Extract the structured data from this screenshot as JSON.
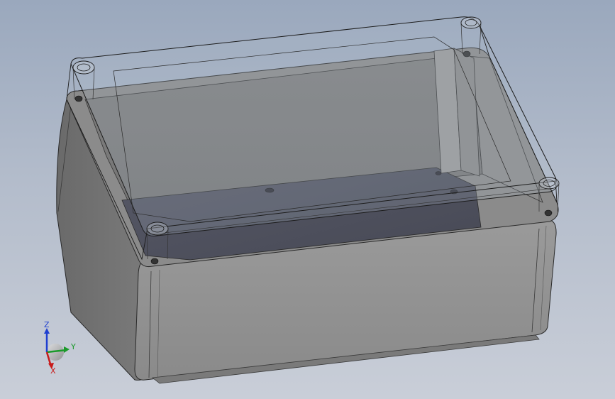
{
  "axis_triad": {
    "z_label": "Z",
    "y_label": "Y",
    "x_label": "X",
    "z_color": "#1f3fd0",
    "y_color": "#1a9a2a",
    "x_color": "#c81a1a"
  },
  "colors": {
    "background_top": "#9aa8bd",
    "background_bottom": "#c9ced8",
    "box_front": "#8e8e8e",
    "box_left": "#6f6f6f",
    "box_interior": "#7d7d7d",
    "box_floor": "#4d4f5c",
    "lid_edge": "#2a2a2a"
  }
}
